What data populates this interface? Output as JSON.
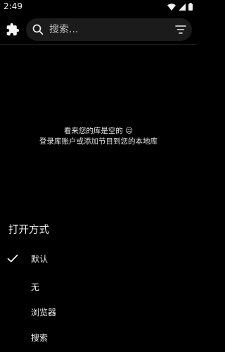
{
  "status_bar": {
    "time": "2:49"
  },
  "search": {
    "placeholder": "搜索..."
  },
  "empty_state": {
    "line1": "看来您的库是空的 ☹",
    "line2": "登录库账户或添加节目到您的本地库"
  },
  "open_with": {
    "title": "打开方式",
    "options": [
      {
        "label": "默认",
        "selected": true
      },
      {
        "label": "无",
        "selected": false
      },
      {
        "label": "浏览器",
        "selected": false
      },
      {
        "label": "搜索",
        "selected": false
      }
    ]
  }
}
